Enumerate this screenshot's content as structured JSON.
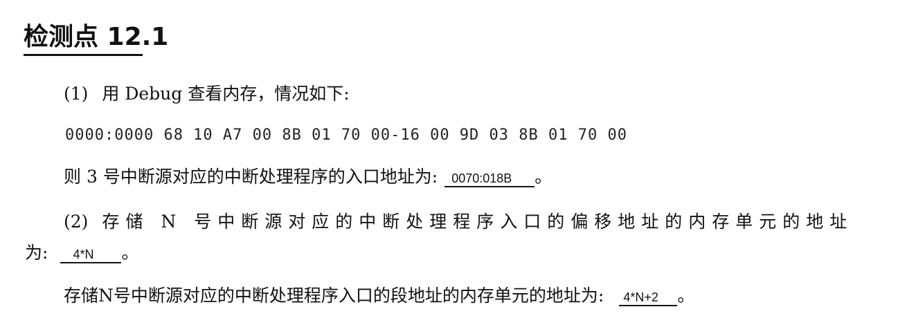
{
  "title": "检测点 12.1",
  "q1": {
    "number": "(1)",
    "intro": "用 Debug 查看内存，情况如下:",
    "dump": "0000:0000  68 10 A7 00 8B 01 70 00-16 00 9D 03 8B 01 70 00",
    "answer_prefix": "则 3 号中断源对应的中断处理程序的入口地址为:",
    "answer": "0070:018B",
    "answer_suffix": "。"
  },
  "q2": {
    "number": "(2)",
    "text_line1": "存储 N 号中断源对应的中断处理程序入口的偏移地址的内存单元的地址",
    "text_line2_prefix": "为:",
    "answer1": "4*N",
    "answer1_suffix": "。",
    "text_line3": "存储N号中断源对应的中断处理程序入口的段地址的内存单元的地址为:",
    "answer2": "4*N+2",
    "answer2_suffix": "。"
  }
}
